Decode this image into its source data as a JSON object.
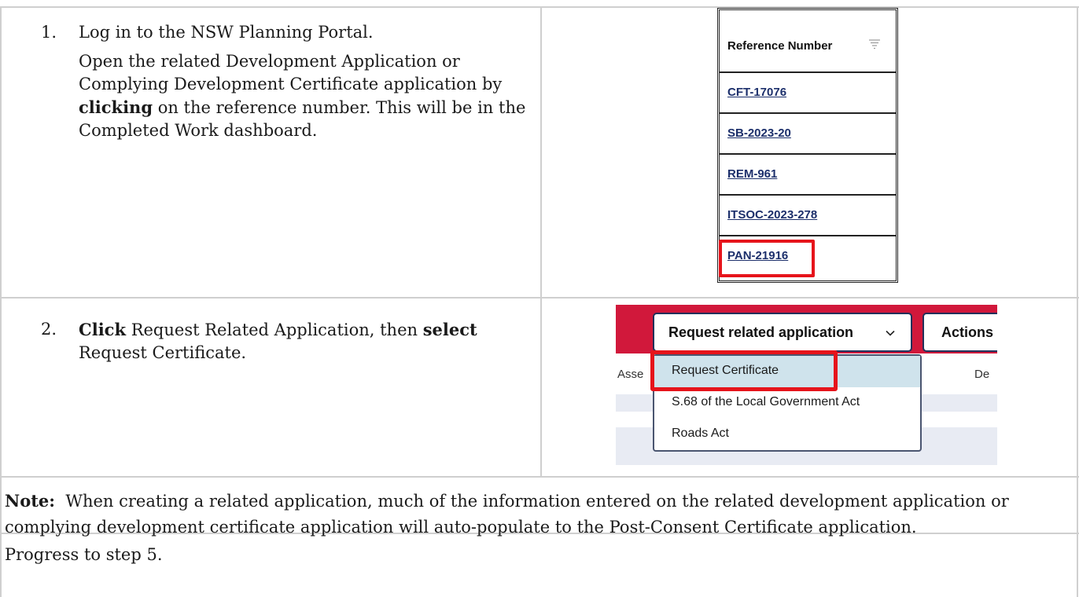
{
  "steps": [
    {
      "number": "1.",
      "line1": "Log in to the NSW Planning Portal.",
      "para_prefix": "Open the related Development Application or Complying Development Certificate application by ",
      "para_bold": "clicking",
      "para_suffix": " on the reference number. This will be in the Completed Work dashboard."
    },
    {
      "number": "2.",
      "bold1": "Click",
      "text1": " Request Related Application, then ",
      "bold2": "select",
      "text2": " Request Certificate."
    }
  ],
  "reference_table": {
    "header": "Reference Number",
    "filter_icon": "filter-lines-icon",
    "rows": [
      "CFT-17076",
      "SB-2023-20",
      "REM-961",
      "ITSOC-2023-278",
      "PAN-21916"
    ],
    "highlighted": "PAN-21916",
    "highlight_color": "#e6141b"
  },
  "request_panel": {
    "button_label": "Request related application",
    "chevron_icon": "chevron-down-icon",
    "actions_label": "Actions",
    "column_left": "Asse",
    "column_right": "De",
    "menu_items": [
      "Request Certificate",
      "S.68 of the Local Government Act",
      "Roads Act"
    ],
    "selected_item": "Request Certificate",
    "brand_color": "#d1183b"
  },
  "note": {
    "label": "Note:",
    "text": "  When creating a related application, much of the information entered on the related development application or complying development certificate application will auto-populate to the Post-Consent Certificate application."
  },
  "progress_text": "Progress to step 5."
}
